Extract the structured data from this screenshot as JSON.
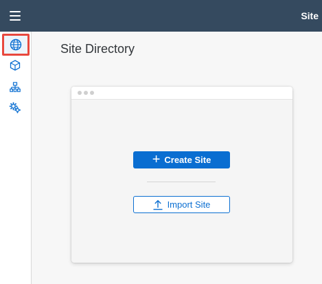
{
  "header": {
    "title": "Site",
    "menu_icon": "hamburger-menu-icon"
  },
  "sidebar": {
    "items": [
      {
        "icon": "globe-icon",
        "selected": true
      },
      {
        "icon": "cube-icon",
        "selected": false
      },
      {
        "icon": "hierarchy-icon",
        "selected": false
      },
      {
        "icon": "gears-icon",
        "selected": false
      }
    ]
  },
  "main": {
    "page_title": "Site Directory",
    "create_button": {
      "label": "Create Site",
      "icon": "plus-icon"
    },
    "import_button": {
      "label": "Import Site",
      "icon": "upload-icon"
    }
  },
  "colors": {
    "header_bg": "#354a5f",
    "accent": "#0a6ed1",
    "selection_outline": "#e8483e"
  }
}
